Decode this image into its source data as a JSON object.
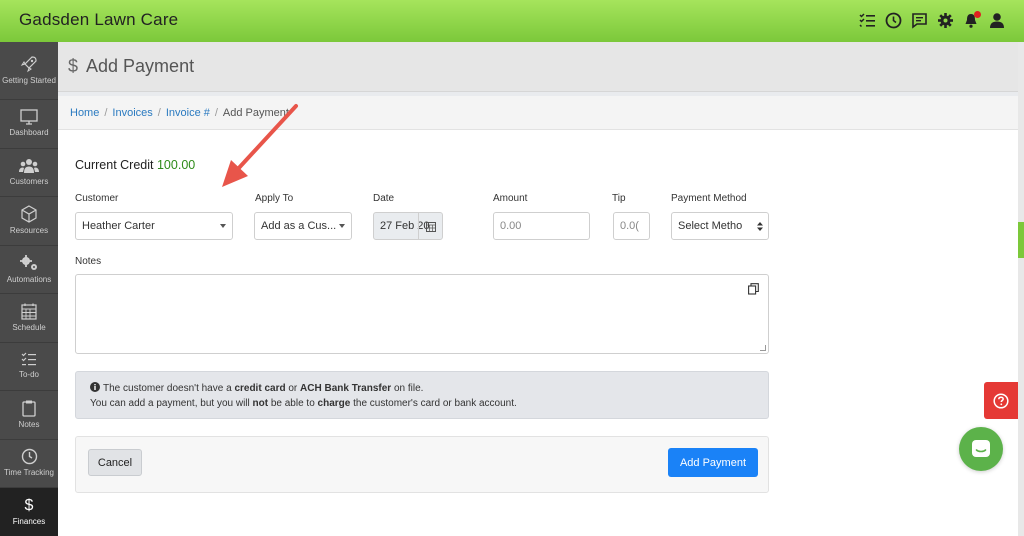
{
  "app": {
    "title": "Gadsden Lawn Care"
  },
  "topbar": {
    "icons": [
      "checklist-icon",
      "clock-icon",
      "chat-icon",
      "gear-icon",
      "bell-icon",
      "user-icon"
    ]
  },
  "sidebar": {
    "items": [
      {
        "label": "Getting Started",
        "icon": "rocket-icon"
      },
      {
        "label": "Dashboard",
        "icon": "monitor-icon"
      },
      {
        "label": "Customers",
        "icon": "users-icon"
      },
      {
        "label": "Resources",
        "icon": "box-icon"
      },
      {
        "label": "Automations",
        "icon": "gears-icon"
      },
      {
        "label": "Schedule",
        "icon": "calendar-icon"
      },
      {
        "label": "To-do",
        "icon": "checklist-icon"
      },
      {
        "label": "Notes",
        "icon": "clipboard-icon"
      },
      {
        "label": "Time Tracking",
        "icon": "clock-icon"
      },
      {
        "label": "Finances",
        "icon": "dollar-icon"
      }
    ]
  },
  "header": {
    "icon": "$",
    "title": "Add Payment"
  },
  "breadcrumb": {
    "home": "Home",
    "invoices": "Invoices",
    "invoice": "Invoice #",
    "current": "Add Payment"
  },
  "credit": {
    "label": "Current Credit",
    "value": "100.00"
  },
  "form": {
    "customer_label": "Customer",
    "customer_value": "Heather Carter",
    "apply_label": "Apply To",
    "apply_value": "Add as a Cus...",
    "date_label": "Date",
    "date_value": "27 Feb 20",
    "amount_label": "Amount",
    "amount_placeholder": "0.00",
    "tip_label": "Tip",
    "tip_placeholder": "0.0(",
    "method_label": "Payment Method",
    "method_value": "Select Metho",
    "notes_label": "Notes"
  },
  "alert": {
    "t1": "The customer doesn't have a ",
    "b1": "credit card",
    "t2": " or ",
    "b2": "ACH Bank Transfer",
    "t3": " on file.",
    "t4": "You can add a payment, but you will ",
    "b3": "not",
    "t5": " be able to ",
    "b4": "charge",
    "t6": " the customer's card or bank account."
  },
  "buttons": {
    "cancel": "Cancel",
    "add": "Add Payment"
  },
  "colors": {
    "topbar": "#8fd64a",
    "primary": "#1a82f7",
    "credit": "#2e8b1a",
    "help": "#e53935",
    "chat": "#5cb24a"
  }
}
